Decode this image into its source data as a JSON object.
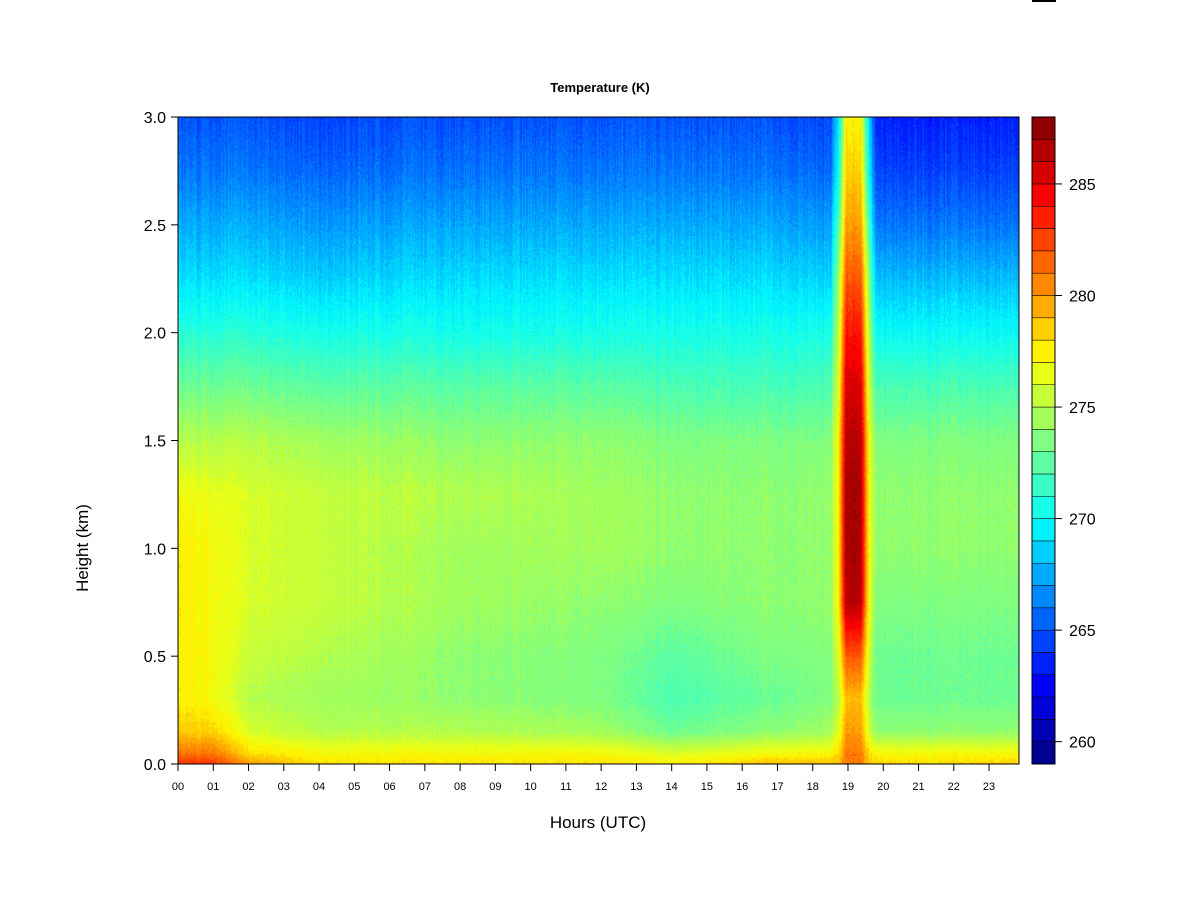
{
  "chart_data": {
    "type": "heatmap",
    "title": "Temperature (K)",
    "xlabel": "Hours (UTC)",
    "ylabel": "Height (km)",
    "xlim": [
      0,
      23.85
    ],
    "ylim": [
      0,
      3.0
    ],
    "x_ticks": [
      "00",
      "01",
      "02",
      "03",
      "04",
      "05",
      "06",
      "07",
      "08",
      "09",
      "10",
      "11",
      "12",
      "13",
      "14",
      "15",
      "16",
      "17",
      "18",
      "19",
      "20",
      "21",
      "22",
      "23"
    ],
    "y_ticks": [
      "0.0",
      "0.5",
      "1.0",
      "1.5",
      "2.0",
      "2.5",
      "3.0"
    ],
    "colorbar": {
      "min": 259,
      "max": 288,
      "bins": 29,
      "ticks": [
        "260",
        "265",
        "270",
        "275",
        "280",
        "285"
      ]
    },
    "heights_km": [
      0,
      0.05,
      0.15,
      0.3,
      0.5,
      0.75,
      1.0,
      1.25,
      1.5,
      1.75,
      2.0,
      2.25,
      2.5,
      2.75,
      3.0
    ],
    "profiles": [
      {
        "hour": 0,
        "temps": [
          283,
          281,
          278.5,
          277.5,
          277.5,
          277.5,
          277.5,
          277,
          275,
          273,
          271,
          269,
          267.5,
          266,
          265
        ]
      },
      {
        "hour": 1,
        "temps": [
          283,
          281,
          278.5,
          277,
          277,
          277,
          277,
          276.5,
          275,
          273,
          271,
          269,
          267.5,
          266,
          265
        ]
      },
      {
        "hour": 2,
        "temps": [
          280,
          278,
          276,
          275,
          275.5,
          276,
          276,
          276,
          275,
          273,
          271,
          269,
          267.5,
          266,
          265
        ]
      },
      {
        "hour": 4,
        "temps": [
          278,
          277,
          275,
          274.5,
          275,
          275.5,
          275.5,
          275.5,
          274.5,
          272.5,
          270.5,
          268.5,
          267,
          265.5,
          264.5
        ]
      },
      {
        "hour": 8,
        "temps": [
          278,
          277,
          275,
          274,
          274,
          274.5,
          274.5,
          275,
          274,
          272.5,
          270.5,
          269,
          267.5,
          266,
          265
        ]
      },
      {
        "hour": 12,
        "temps": [
          278,
          277,
          274.5,
          273.5,
          273.5,
          274,
          274.5,
          274.5,
          274,
          272.5,
          270.5,
          269,
          267.5,
          266,
          265
        ]
      },
      {
        "hour": 14,
        "temps": [
          277.5,
          276,
          273,
          272,
          272.5,
          273.5,
          274,
          274,
          273.5,
          272,
          270.5,
          269,
          267.5,
          266,
          265
        ]
      },
      {
        "hour": 17,
        "temps": [
          279,
          277,
          274,
          273,
          273.5,
          274,
          274,
          274,
          273.5,
          272,
          270.5,
          269,
          267.5,
          266,
          265
        ]
      },
      {
        "hour": 18.5,
        "temps": [
          279,
          277,
          274.5,
          273.5,
          273.5,
          274,
          274,
          274,
          273.5,
          272,
          270.5,
          268.5,
          267,
          265.5,
          264.5
        ]
      },
      {
        "hour": 18.72,
        "temps": [
          279,
          278,
          276,
          275,
          276,
          277,
          277,
          277,
          277,
          276,
          275,
          274,
          272,
          270,
          269
        ]
      },
      {
        "hour": 18.95,
        "temps": [
          281,
          281,
          280,
          279,
          282,
          286.5,
          287,
          287,
          286.5,
          285.5,
          284,
          282,
          280,
          278.5,
          277.5
        ]
      },
      {
        "hour": 19.35,
        "temps": [
          281,
          281,
          280,
          279,
          282,
          286.5,
          287,
          287,
          286.5,
          285.5,
          284,
          282,
          280,
          278.5,
          277.5
        ]
      },
      {
        "hour": 19.6,
        "temps": [
          279,
          278,
          276,
          275,
          276,
          277,
          277,
          277,
          277,
          276,
          275,
          274,
          272,
          270,
          269
        ]
      },
      {
        "hour": 19.8,
        "temps": [
          278.5,
          277,
          274,
          273,
          273,
          273.5,
          274,
          274,
          273.5,
          272,
          270,
          268,
          266,
          264.5,
          263.5
        ]
      },
      {
        "hour": 21,
        "temps": [
          278,
          277,
          274,
          273,
          273,
          273.5,
          274,
          274,
          273.5,
          272,
          270,
          268,
          266,
          264.5,
          263.5
        ]
      },
      {
        "hour": 23.85,
        "temps": [
          278.5,
          277,
          274,
          273,
          273,
          273.5,
          274,
          274,
          273.5,
          272,
          270,
          268,
          266,
          264.5,
          263.5
        ]
      }
    ]
  }
}
